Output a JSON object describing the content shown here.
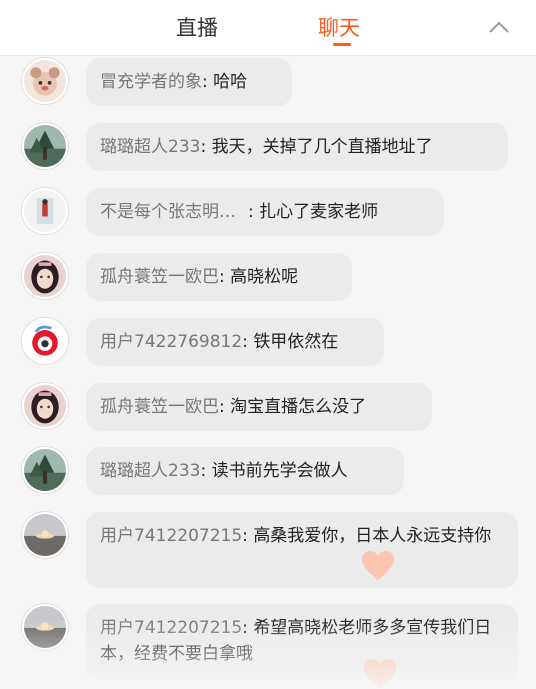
{
  "tabs": {
    "live": "直播",
    "chat": "聊天"
  },
  "icons": {
    "collapse": "chevron-up-icon",
    "like": "heart-icon"
  },
  "colors": {
    "accent": "#ff5a1f",
    "bubble": "#ebebeb",
    "name": "#777777",
    "heart": "#ffc0a8"
  },
  "messages": [
    {
      "name": "冒充学者的象",
      "text": "哈哈"
    },
    {
      "name": "璐璐超人233",
      "text": "我天，关掉了几个直播地址了"
    },
    {
      "name": "不是每个张志明…",
      "text": "扎心了麦家老师"
    },
    {
      "name": "孤舟蓑笠一欧巴",
      "text": "高晓松呢"
    },
    {
      "name": "用户7422769812",
      "text": "铁甲依然在"
    },
    {
      "name": "孤舟蓑笠一欧巴",
      "text": "淘宝直播怎么没了"
    },
    {
      "name": "璐璐超人233",
      "text": "读书前先学会做人"
    },
    {
      "name": "用户7412207215",
      "text": "高桑我爱你，日本人永远支持你"
    },
    {
      "name": "用户7412207215",
      "text": "希望高晓松老师多多宣传我们日本，经费不要白拿哦"
    }
  ]
}
